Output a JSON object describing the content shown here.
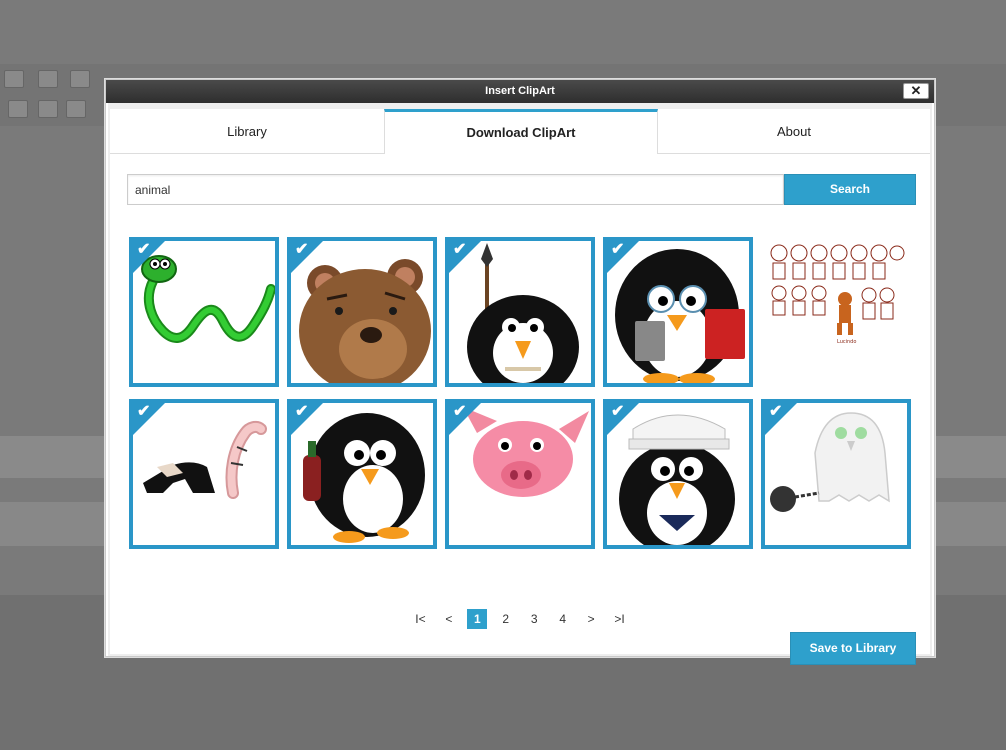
{
  "dialog": {
    "title": "Insert ClipArt",
    "close_label": "✕"
  },
  "tabs": [
    {
      "label": "Library",
      "active": false
    },
    {
      "label": "Download ClipArt",
      "active": true
    },
    {
      "label": "About",
      "active": false
    }
  ],
  "search": {
    "value": "animal",
    "button_label": "Search"
  },
  "results": [
    {
      "name": "snake",
      "selected": true
    },
    {
      "name": "bear",
      "selected": true
    },
    {
      "name": "tribal-penguin",
      "selected": true
    },
    {
      "name": "book-penguin",
      "selected": true
    },
    {
      "name": "cartoon-figures",
      "selected": false
    },
    {
      "name": "anteater",
      "selected": true
    },
    {
      "name": "wine-penguin",
      "selected": true
    },
    {
      "name": "pig",
      "selected": true
    },
    {
      "name": "sailor-penguin",
      "selected": true
    },
    {
      "name": "ghost-ball-chain",
      "selected": true
    }
  ],
  "pagination": {
    "first": "I<",
    "prev": "<",
    "pages": [
      "1",
      "2",
      "3",
      "4"
    ],
    "current": "1",
    "next": ">",
    "last": ">I"
  },
  "save_button_label": "Save to Library",
  "colors": {
    "accent": "#2ea0cc",
    "selection_border": "#2a96c8"
  }
}
